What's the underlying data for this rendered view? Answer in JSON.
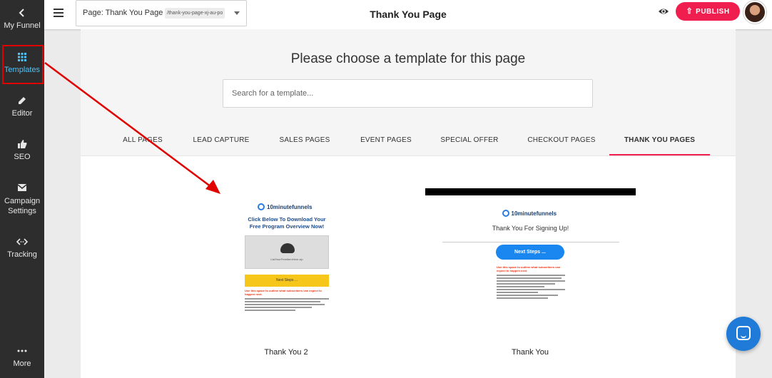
{
  "sidebar": {
    "items": [
      {
        "label": "My Funnel",
        "icon": "chevron-left-icon"
      },
      {
        "label": "Templates",
        "icon": "grid-icon"
      },
      {
        "label": "Editor",
        "icon": "pencil-icon"
      },
      {
        "label": "SEO",
        "icon": "thumbs-up-icon"
      },
      {
        "label": "Campaign Settings",
        "icon": "envelope-icon"
      },
      {
        "label": "Tracking",
        "icon": "code-icon"
      },
      {
        "label": "More",
        "icon": "more-dots-icon"
      }
    ],
    "active": "Templates",
    "active_color": "#4fc3f7"
  },
  "topbar": {
    "page_select_label": "Page: Thank You Page",
    "page_slug": "/thank-you-page-xj-au-po",
    "title": "Thank You Page",
    "publish_label": "PUBLISH",
    "accent": "#ef1e4f"
  },
  "main": {
    "heading": "Please choose a template for this page",
    "search_placeholder": "Search for a template...",
    "tabs": [
      {
        "label": "ALL PAGES"
      },
      {
        "label": "LEAD CAPTURE"
      },
      {
        "label": "SALES PAGES"
      },
      {
        "label": "EVENT PAGES"
      },
      {
        "label": "SPECIAL OFFER"
      },
      {
        "label": "CHECKOUT PAGES"
      },
      {
        "label": "THANK YOU PAGES"
      }
    ],
    "active_tab": "THANK YOU PAGES",
    "templates": [
      {
        "name": "Thank You 2",
        "thumb": {
          "logo": "10minutefunnels",
          "headline": "Click Below To Download Your Free Program Overview Now!",
          "file_name": "ListYourFreeItemHere.zip",
          "button": "Next Steps ...",
          "note": "Use this space to outline what subscribers can expect to happen next."
        }
      },
      {
        "name": "Thank You",
        "thumb": {
          "logo": "10minutefunnels",
          "headline": "Thank You For Signing Up!",
          "button": "Next Steps ...",
          "note": "Use this space to outline what subscribers can expect to happen next."
        }
      }
    ]
  }
}
